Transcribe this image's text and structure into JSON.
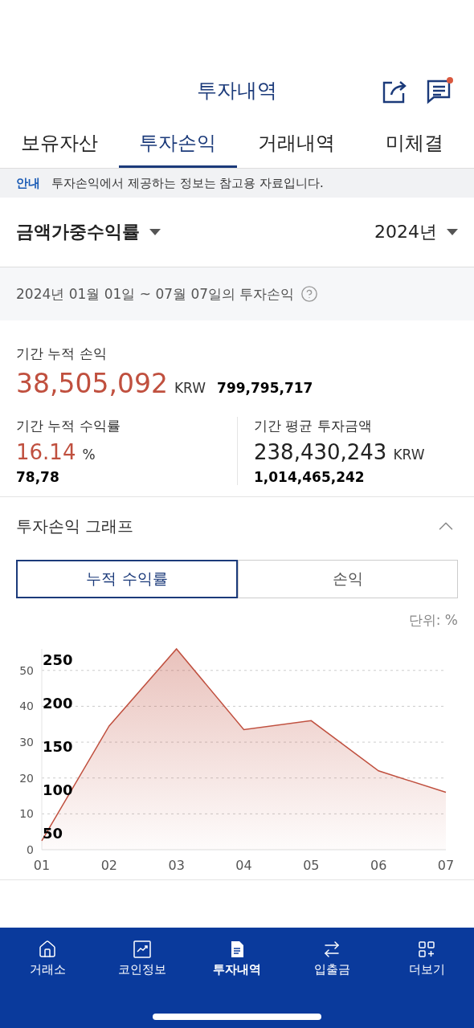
{
  "header": {
    "title": "투자내역",
    "notification_dot": true
  },
  "tabs": [
    {
      "label": "보유자산",
      "selected": false
    },
    {
      "label": "투자손익",
      "selected": true
    },
    {
      "label": "거래내역",
      "selected": false
    },
    {
      "label": "미체결",
      "selected": false
    }
  ],
  "notice": {
    "tag": "안내",
    "text": "투자손익에서 제공하는 정보는 참고용 자료입니다."
  },
  "selectors": [
    {
      "label": "금액가중수익률"
    },
    {
      "label": "2024년"
    }
  ],
  "period": {
    "text": "2024년 01월 01일 ~ 07월 07일의 투자손익"
  },
  "stats": [
    {
      "kind": "wide",
      "label": "기간 누적 손익",
      "value": "38,505,092",
      "color": "#c0503f",
      "unit": "KRW",
      "overlay": "799,795,717"
    },
    {
      "kind": "half",
      "label": "기간 누적 수익률",
      "value": "16.14",
      "color": "#c0503f",
      "unit": "%",
      "overlay": "78,78"
    },
    {
      "kind": "half",
      "label": "기간 평균 투자금액",
      "value": "238,430,243",
      "color": "#222222",
      "unit": "KRW",
      "overlay": "1,014,465,242"
    }
  ],
  "graph": {
    "title": "투자손익 그래프",
    "expanded": true,
    "toggle": [
      {
        "label": "누적 수익률",
        "selected": true
      },
      {
        "label": "손익",
        "selected": false
      }
    ],
    "unit": "단위: %",
    "chart_data": {
      "type": "area",
      "categories": [
        "01",
        "02",
        "03",
        "04",
        "05",
        "06",
        "07"
      ],
      "ylim": [
        0,
        56
      ],
      "yticks": [
        0,
        10,
        20,
        30,
        40,
        50
      ],
      "grid": true,
      "series": [
        {
          "color": "#c0503f",
          "values": [
            2.5,
            34.5,
            56,
            33.5,
            36,
            22,
            16
          ]
        }
      ]
    },
    "overlay_labels": [
      "250",
      "200",
      "150",
      "100",
      "50"
    ]
  },
  "nav": [
    {
      "label": "거래소",
      "kind": "home",
      "selected": false
    },
    {
      "label": "코인정보",
      "kind": "chart",
      "selected": false
    },
    {
      "label": "투자내역",
      "kind": "doc",
      "selected": true
    },
    {
      "label": "입출금",
      "kind": "swap",
      "selected": false
    },
    {
      "label": "더보기",
      "kind": "more",
      "selected": false
    }
  ]
}
